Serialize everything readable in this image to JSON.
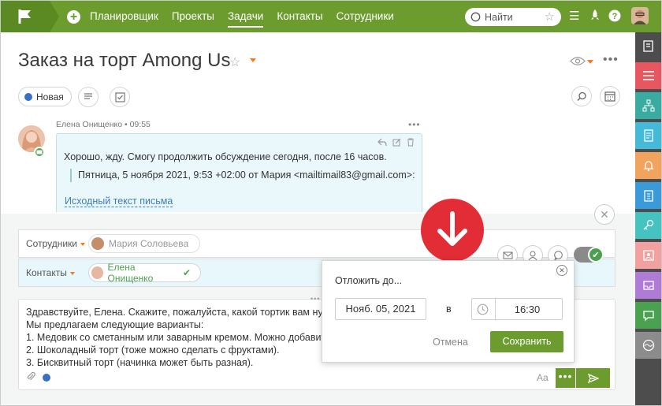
{
  "topnav": {
    "items": [
      "Планировщик",
      "Проекты",
      "Задачи",
      "Контакты",
      "Сотрудники"
    ],
    "active_index": 2,
    "search_placeholder": "Найти"
  },
  "task": {
    "title": "Заказ на торт Among Us",
    "status": "Новая"
  },
  "message": {
    "author": "Елена Онищенко",
    "time": "09:55",
    "text": "Хорошо, жду. Смогу продолжить обсуждение сегодня, после 16 часов.",
    "quote": "Пятница, 5 ноября 2021, 9:53 +02:00 от Мария <mailtimail83@gmail.com>:",
    "original_link": "Исходный текст письма"
  },
  "composer": {
    "employees_label": "Сотрудники",
    "employee_name": "Мария Соловьева",
    "contacts_label": "Контакты",
    "contact_name": "Елена Онищенко",
    "lines": [
      "Здравствуйте, Елена. Скажите, пожалуйста, какой тортик вам ну",
      "Мы предлагаем следующие варианты:",
      "1. Медовик со сметанным или заварным кремом. Можно добавит",
      "2. Шоколадный торт (тоже можно сделать с фруктами).",
      "3. Бисквитный торт (начинка может быть разная)."
    ],
    "font_toggle": "Aa"
  },
  "postpone": {
    "title": "Отложить до...",
    "date": "Нояб. 05, 2021",
    "at_label": "в",
    "time": "16:30",
    "cancel": "Отмена",
    "save": "Сохранить"
  },
  "colors": {
    "brand_green": "#6c9c2d",
    "rail_dark": "#4d4d4d",
    "alert_red": "#e32d36",
    "status_blue": "#3b6fc4"
  },
  "rail_icons": [
    "edit-icon",
    "list-icon",
    "org-chart-icon",
    "documents-icon",
    "bell-icon",
    "clipboard-icon",
    "key-icon",
    "contact-card-icon",
    "inbox-icon",
    "chat-icon",
    "wave-icon"
  ],
  "rail_colors": [
    "#4d4d4d",
    "#e8565f",
    "#3aaba0",
    "#45b9d8",
    "#f2a35e",
    "#3b9bd8",
    "#45c3c0",
    "#f2a0a0",
    "#b07bd6",
    "#4aa251",
    "#8c8c8c"
  ]
}
